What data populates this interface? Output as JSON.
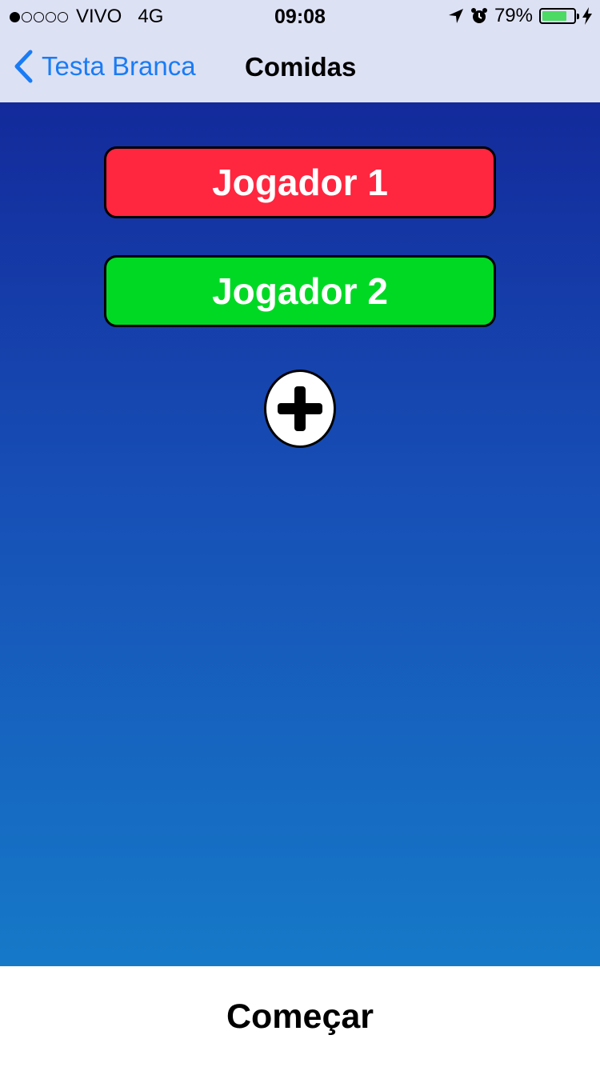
{
  "status_bar": {
    "signal_dots_filled": 1,
    "signal_dots_total": 5,
    "carrier": "VIVO",
    "network": "4G",
    "time": "09:08",
    "battery_percent": "79%",
    "battery_level": 0.79,
    "icons": [
      "location-arrow-icon",
      "alarm-icon",
      "battery-icon",
      "charging-bolt-icon"
    ]
  },
  "nav": {
    "back_label": "Testa Branca",
    "title": "Comidas"
  },
  "players": [
    {
      "label": "Jogador 1",
      "color": "#ff2640"
    },
    {
      "label": "Jogador 2",
      "color": "#00d924"
    }
  ],
  "add_player_icon": "plus-icon",
  "footer": {
    "start_label": "Começar"
  },
  "colors": {
    "nav_background": "#dde1f4",
    "accent_blue": "#1a7cf5",
    "gradient_top": "#132a9b",
    "gradient_bottom": "#1679c8"
  }
}
